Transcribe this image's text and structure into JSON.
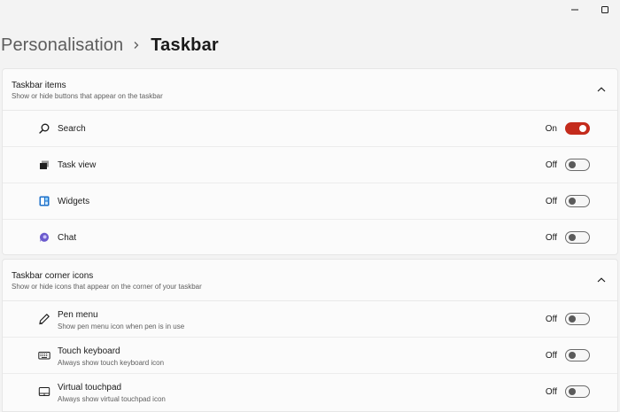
{
  "window": {
    "minimize_icon": "minimize-icon",
    "maximize_icon": "maximize-icon"
  },
  "breadcrumb": {
    "parent": "Personalisation",
    "separator_icon": "chevron-right-icon",
    "current": "Taskbar"
  },
  "sections": [
    {
      "title": "Taskbar items",
      "subtitle": "Show or hide buttons that appear on the taskbar",
      "expanded": true,
      "items": [
        {
          "label": "Search",
          "state": "On",
          "on": true,
          "icon": "search-icon"
        },
        {
          "label": "Task view",
          "state": "Off",
          "on": false,
          "icon": "task-view-icon"
        },
        {
          "label": "Widgets",
          "state": "Off",
          "on": false,
          "icon": "widgets-icon"
        },
        {
          "label": "Chat",
          "state": "Off",
          "on": false,
          "icon": "chat-icon"
        }
      ]
    },
    {
      "title": "Taskbar corner icons",
      "subtitle": "Show or hide icons that appear on the corner of your taskbar",
      "expanded": true,
      "items": [
        {
          "label": "Pen menu",
          "description": "Show pen menu icon when pen is in use",
          "state": "Off",
          "on": false,
          "icon": "pen-icon"
        },
        {
          "label": "Touch keyboard",
          "description": "Always show touch keyboard icon",
          "state": "Off",
          "on": false,
          "icon": "keyboard-icon"
        },
        {
          "label": "Virtual touchpad",
          "description": "Always show virtual touchpad icon",
          "state": "Off",
          "on": false,
          "icon": "touchpad-icon"
        }
      ]
    }
  ],
  "colors": {
    "accent": "#c42b1c",
    "background": "#f3f3f3",
    "card": "#fbfbfb"
  }
}
